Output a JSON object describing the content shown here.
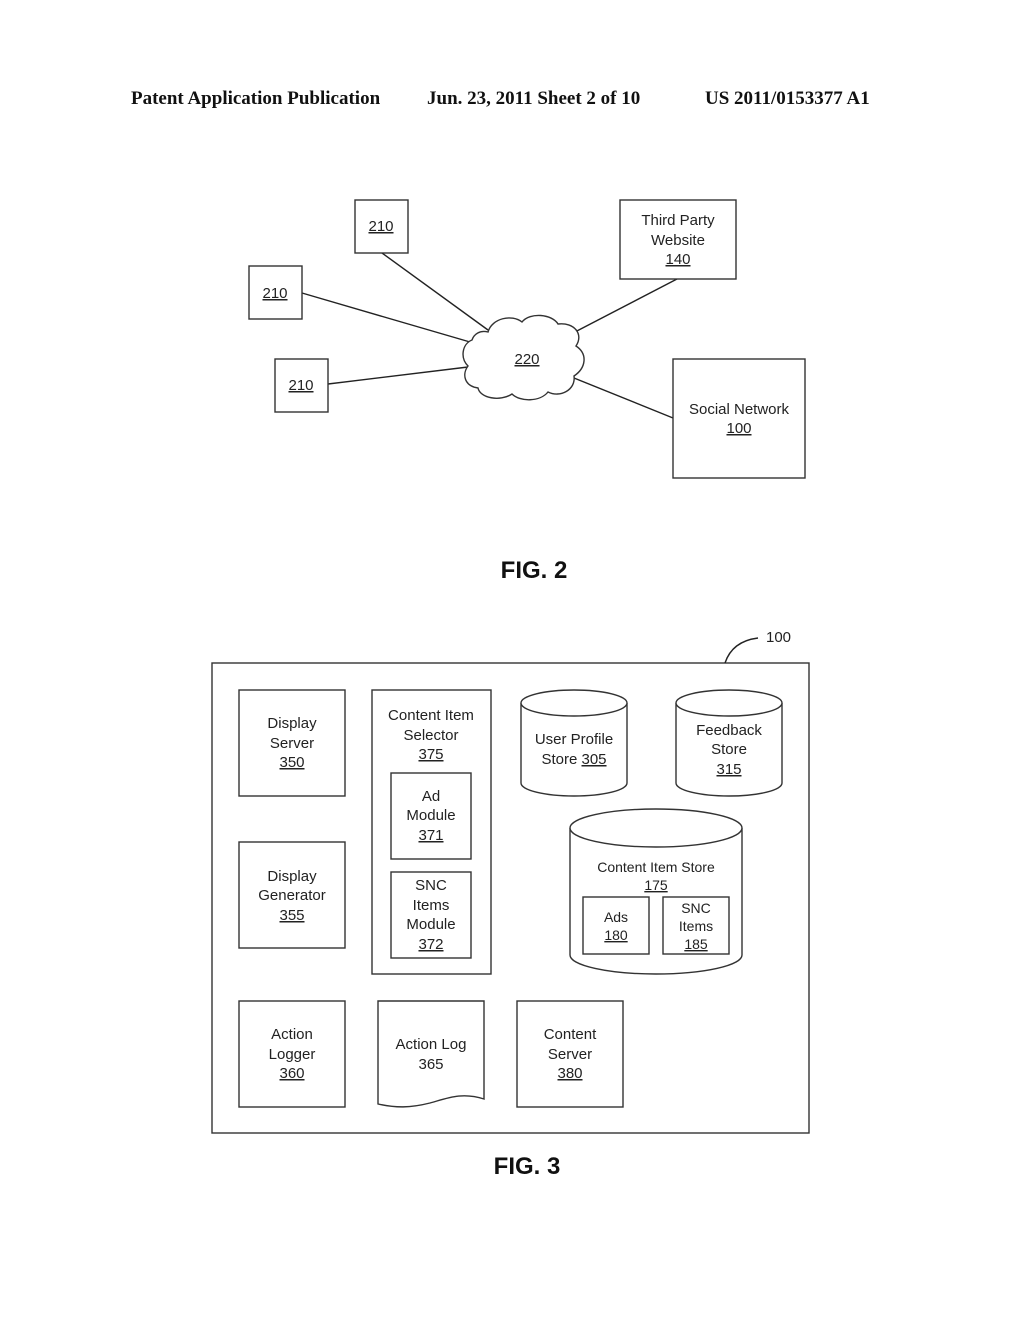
{
  "header": {
    "publication": "Patent Application Publication",
    "date_sheet": "Jun. 23, 2011   Sheet 2 of 10",
    "patent_number": "US 2011/0153377 A1"
  },
  "fig2": {
    "caption": "FIG. 2",
    "client_devices": [
      {
        "ref": "210"
      },
      {
        "ref": "210"
      },
      {
        "ref": "210"
      }
    ],
    "network": {
      "ref": "220"
    },
    "third_party": {
      "lines": [
        "Third Party",
        "Website"
      ],
      "ref": "140"
    },
    "social_network": {
      "lines": [
        "Social Network"
      ],
      "ref": "100"
    }
  },
  "fig3": {
    "caption": "FIG. 3",
    "system_ref": "100",
    "display_server": {
      "lines": [
        "Display",
        "Server"
      ],
      "ref": "350"
    },
    "display_generator": {
      "lines": [
        "Display",
        "Generator"
      ],
      "ref": "355"
    },
    "content_item_selector": {
      "lines": [
        "Content Item",
        "Selector"
      ],
      "ref": "375"
    },
    "ad_module": {
      "lines": [
        "Ad",
        "Module"
      ],
      "ref": "371"
    },
    "snc_items_module": {
      "lines": [
        "SNC",
        "Items",
        "Module"
      ],
      "ref": "372"
    },
    "user_profile_store": {
      "lines": [
        "User Profile"
      ],
      "line2_prefix": "Store ",
      "ref": "305"
    },
    "feedback_store": {
      "lines": [
        "Feedback",
        "Store"
      ],
      "ref": "315"
    },
    "content_item_store": {
      "lines": [
        "Content Item Store"
      ],
      "ref": "175"
    },
    "ads": {
      "lines": [
        "Ads"
      ],
      "ref": "180"
    },
    "snc_items": {
      "lines": [
        "SNC",
        "Items"
      ],
      "ref": "185"
    },
    "action_logger": {
      "lines": [
        "Action",
        "Logger"
      ],
      "ref": "360"
    },
    "action_log": {
      "lines": [
        "Action Log"
      ],
      "ref": "365"
    },
    "content_server": {
      "lines": [
        "Content",
        "Server"
      ],
      "ref": "380"
    }
  }
}
